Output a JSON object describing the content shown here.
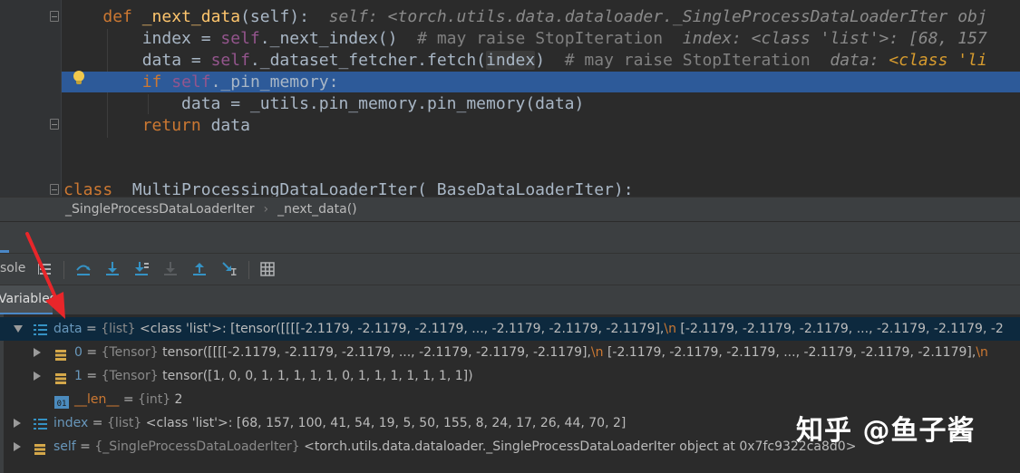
{
  "editor": {
    "lines": [
      {
        "indent": "    ",
        "kw": "def",
        "name": "_next_data",
        "params": "(self):",
        "hint": "self: <torch.utils.data.dataloader._SingleProcessDataLoaderIter obj"
      },
      {
        "code_a": "index = ",
        "self": "self",
        "code_b": "._next_index()",
        "comment": "# may raise StopIteration",
        "hint": "index: <class 'list'>: [68, 157"
      },
      {
        "code_a": "data = ",
        "self": "self",
        "code_b": "._dataset_fetcher.fetch(",
        "ref": "index",
        "code_c": ")",
        "comment": "# may raise StopIteration",
        "hint": "data: ",
        "hint_or": "<class 'li"
      },
      {
        "kw": "if",
        "self": "self",
        "code_b": "._pin_memory:"
      },
      {
        "code_a": "data = _utils.pin_memory.pin_memory(data)"
      },
      {
        "kw": "return",
        "code_a": " data"
      },
      {
        "kw": "class",
        "code_a": " _MultiProcessingDataLoaderIter(_BaseDataLoaderIter):"
      }
    ]
  },
  "breadcrumb": {
    "items": [
      "_SingleProcessDataLoaderIter",
      "_next_data()"
    ],
    "separator": "›"
  },
  "toolbar": {
    "console_label": "sole"
  },
  "variables_tab": {
    "label": "Variables"
  },
  "variables": [
    {
      "name": "data",
      "eq": " = ",
      "type": "{list}",
      "value": " <class 'list'>: [tensor([[[[-2.1179, -2.1179, -2.1179,  ..., -2.1179, -2.1179, -2.1179],",
      "nl": "\\n",
      "value2": "          [-2.1179, -2.1179, -2.1179,  ..., -2.1179, -2.1179, -2"
    },
    {
      "name": "0",
      "eq": " = ",
      "type": "{Tensor}",
      "value": " tensor([[[[-2.1179, -2.1179, -2.1179,  ..., -2.1179, -2.1179, -2.1179],",
      "nl": "\\n",
      "value2": "          [-2.1179, -2.1179, -2.1179,  ..., -2.1179, -2.1179, -2.1179],",
      "nl2": "\\n"
    },
    {
      "name": "1",
      "eq": " = ",
      "type": "{Tensor}",
      "value": " tensor([1, 0, 0, 1, 1, 1, 1, 1, 0, 1, 1, 1, 1, 1, 1, 1])"
    },
    {
      "name": "__len__",
      "eq": " = ",
      "type": "{int}",
      "value": " 2"
    },
    {
      "name": "index",
      "eq": " = ",
      "type": "{list}",
      "value": " <class 'list'>: [68, 157, 100, 41, 54, 19, 5, 50, 155, 8, 24, 17, 26, 44, 70, 2]"
    },
    {
      "name": "self",
      "eq": " = ",
      "type": "{_SingleProcessDataLoaderIter}",
      "value": " <torch.utils.data.dataloader._SingleProcessDataLoaderIter object at 0x7fc9322ca8d0>"
    }
  ],
  "watermark": "知乎 @鱼子酱",
  "colors": {
    "editor_bg": "#2b2b2b",
    "highlight": "#2d5a99",
    "keyword": "#cc7832",
    "self": "#94558d",
    "var_name": "#6897bb",
    "arrow": "#e8262a"
  }
}
